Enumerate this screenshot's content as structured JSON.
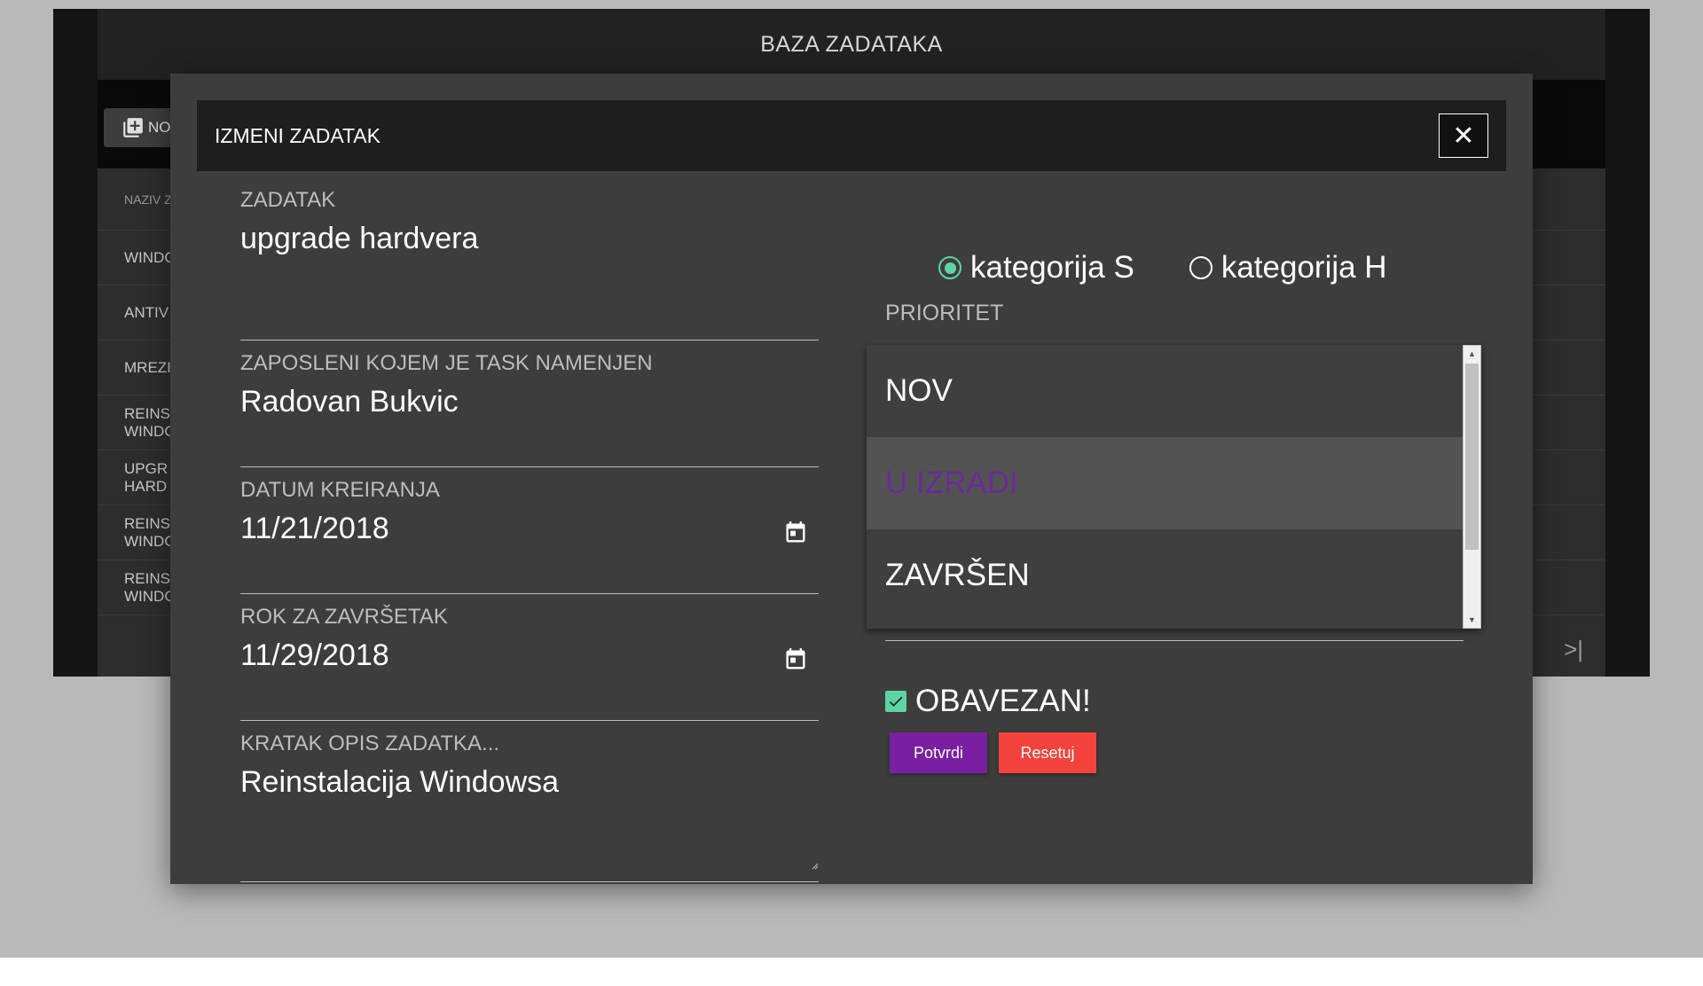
{
  "background": {
    "app_title": "BAZA ZADATAKA",
    "new_button_label": "NO",
    "table_header": "NAZIV Z",
    "rows": [
      "WINDO",
      "ANTIV",
      "MREZI",
      "REINS\nWINDO",
      "UPGR\nHARD",
      "REINS\nWINDO",
      "REINS\nWINDO"
    ],
    "pager_last": ">|"
  },
  "modal": {
    "title": "IZMENI ZADATAK",
    "close_icon": "close-icon",
    "fields": {
      "task": {
        "label": "ZADATAK",
        "value": "upgrade hardvera"
      },
      "employee": {
        "label": "ZAPOSLENI KOJEM JE TASK NAMENJEN",
        "value": "Radovan Bukvic"
      },
      "created": {
        "label": "DATUM KREIRANJA",
        "value": "11/21/2018"
      },
      "deadline": {
        "label": "ROK ZA ZAVRŠETAK",
        "value": "11/29/2018"
      },
      "description": {
        "label": "KRATAK OPIS ZADATKA...",
        "value": "Reinstalacija Windowsa"
      }
    },
    "category": {
      "options": [
        "kategorija S",
        "kategorija H"
      ],
      "selected": "kategorija S"
    },
    "priority": {
      "label": "PRIORITET",
      "options": [
        "NOV",
        "U IZRADI",
        "ZAVRŠEN"
      ],
      "selected": "U IZRADI"
    },
    "mandatory": {
      "label": "OBAVEZAN!",
      "checked": true
    },
    "buttons": {
      "confirm": "Potvrdi",
      "reset": "Resetuj"
    }
  },
  "colors": {
    "accent_green": "#5ed3a4",
    "confirm_purple": "#7b1fa2",
    "reset_red": "#f4433c",
    "selected_text": "#6b2a99"
  }
}
